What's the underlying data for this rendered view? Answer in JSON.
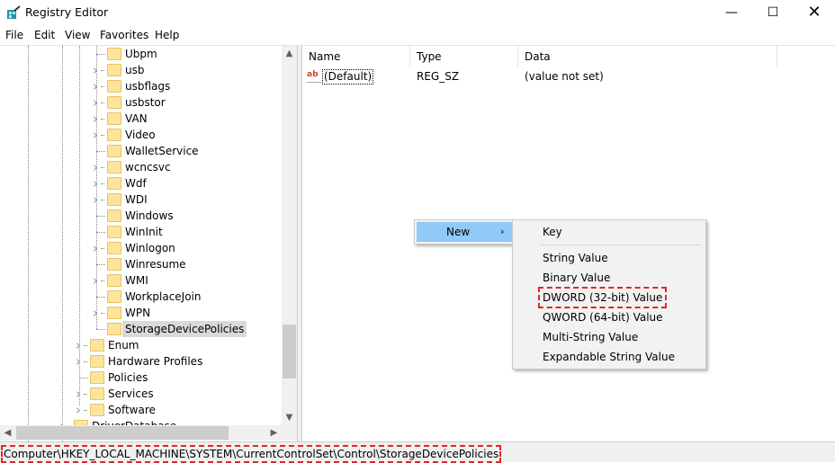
{
  "window": {
    "title": "Registry Editor",
    "icon": "regedit-icon"
  },
  "menubar": [
    "File",
    "Edit",
    "View",
    "Favorites",
    "Help"
  ],
  "tree": {
    "items": [
      {
        "label": "Ubpm",
        "expandable": false,
        "level": 2
      },
      {
        "label": "usb",
        "expandable": true,
        "level": 2
      },
      {
        "label": "usbflags",
        "expandable": true,
        "level": 2
      },
      {
        "label": "usbstor",
        "expandable": true,
        "level": 2
      },
      {
        "label": "VAN",
        "expandable": true,
        "level": 2
      },
      {
        "label": "Video",
        "expandable": true,
        "level": 2
      },
      {
        "label": "WalletService",
        "expandable": false,
        "level": 2
      },
      {
        "label": "wcncsvc",
        "expandable": true,
        "level": 2
      },
      {
        "label": "Wdf",
        "expandable": true,
        "level": 2
      },
      {
        "label": "WDI",
        "expandable": true,
        "level": 2
      },
      {
        "label": "Windows",
        "expandable": false,
        "level": 2
      },
      {
        "label": "WinInit",
        "expandable": false,
        "level": 2
      },
      {
        "label": "Winlogon",
        "expandable": true,
        "level": 2
      },
      {
        "label": "Winresume",
        "expandable": false,
        "level": 2
      },
      {
        "label": "WMI",
        "expandable": true,
        "level": 2
      },
      {
        "label": "WorkplaceJoin",
        "expandable": false,
        "level": 2
      },
      {
        "label": "WPN",
        "expandable": true,
        "level": 2
      },
      {
        "label": "StorageDevicePolicies",
        "expandable": false,
        "level": 2,
        "selected": true
      },
      {
        "label": "Enum",
        "expandable": true,
        "level": 1
      },
      {
        "label": "Hardware Profiles",
        "expandable": true,
        "level": 1
      },
      {
        "label": "Policies",
        "expandable": false,
        "level": 1
      },
      {
        "label": "Services",
        "expandable": true,
        "level": 1
      },
      {
        "label": "Software",
        "expandable": true,
        "level": 1
      },
      {
        "label": "DriverDatabase",
        "expandable": true,
        "level": 0
      }
    ]
  },
  "list": {
    "columns": [
      "Name",
      "Type",
      "Data"
    ],
    "rows": [
      {
        "name": "(Default)",
        "type": "REG_SZ",
        "data": "(value not set)",
        "icon": "string-value-icon"
      }
    ]
  },
  "context_menu": {
    "new_label": "New",
    "submenu": [
      "Key",
      "String Value",
      "Binary Value",
      "DWORD (32-bit) Value",
      "QWORD (64-bit) Value",
      "Multi-String Value",
      "Expandable String Value"
    ],
    "highlighted": "DWORD (32-bit) Value"
  },
  "status": {
    "path": "Computer\\HKEY_LOCAL_MACHINE\\SYSTEM\\CurrentControlSet\\Control\\StorageDevicePolicies"
  },
  "colors": {
    "selection": "#91c9f7",
    "annotation": "#e0262b",
    "folder": "#fde49a"
  }
}
